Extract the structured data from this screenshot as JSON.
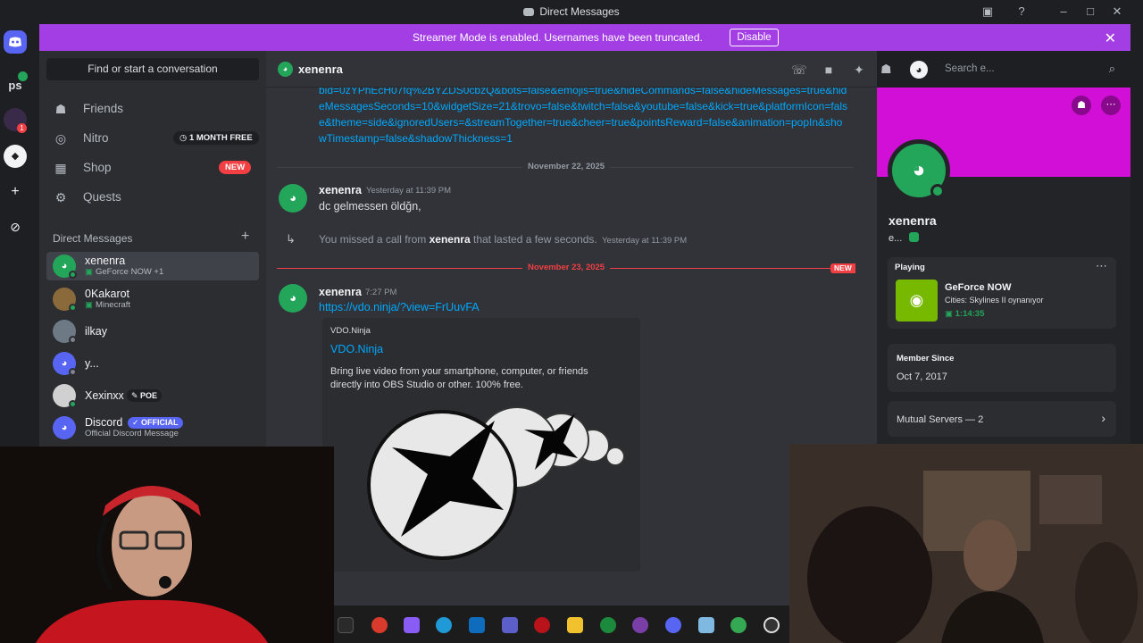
{
  "window": {
    "title": "Direct Messages"
  },
  "banner": {
    "message": "Streamer Mode is enabled. Usernames have been truncated.",
    "disable_label": "Disable",
    "color": "#a33de4"
  },
  "rail": {
    "guilds": [
      "ps"
    ],
    "badge_count": "1"
  },
  "sidebar": {
    "find_placeholder": "Find or start a conversation",
    "nav": [
      {
        "label": "Friends",
        "icon": "friends-icon"
      },
      {
        "label": "Nitro",
        "icon": "nitro-icon",
        "pill": "1 MONTH FREE"
      },
      {
        "label": "Shop",
        "icon": "shop-icon",
        "pill": "NEW"
      },
      {
        "label": "Quests",
        "icon": "quests-icon"
      }
    ],
    "dm_header": "Direct Messages",
    "dms": [
      {
        "name": "xenenra",
        "sub": "GeForce NOW +1",
        "status": "online"
      },
      {
        "name": "0Kakarot",
        "sub": "Minecraft",
        "status": "online"
      },
      {
        "name": "ilkay",
        "sub": "",
        "status": "offline"
      },
      {
        "name": "y...",
        "sub": "",
        "status": "offline"
      },
      {
        "name": "Xexinxx",
        "tag": "POE",
        "sub": "",
        "status": "online"
      },
      {
        "name": "Discord",
        "tag": "OFFICIAL",
        "sub": "Official Discord Message",
        "status": ""
      }
    ]
  },
  "chat": {
    "header_name": "xenenra",
    "search_placeholder": "Search e...",
    "link_block": "bid=0zYPhEcH07fq%2BYZDS0cbzQ&bots=false&emojis=true&hideCommands=false&hideMessages=true&hideMessagesSeconds=10&widgetSize=21&trovo=false&twitch=false&youtube=false&kick=true&platformIcon=false&theme=side&ignoredUsers=&streamTogether=true&cheer=true&pointsReward=false&animation=popIn&showTimestamp=false&shadowThickness=1",
    "date1": "November 22, 2025",
    "msg1": {
      "author": "xenenra",
      "time": "Yesterday at 11:39 PM",
      "text": "dc gelmessen öldğn,"
    },
    "call": {
      "prefix": "You missed a call from",
      "author": "xenenra",
      "suffix": "that lasted a few seconds.",
      "time": "Yesterday at 11:39 PM"
    },
    "date2": "November 23, 2025",
    "new_label": "NEW",
    "msg2": {
      "author": "xenenra",
      "time": "7:27 PM",
      "link": "https://vdo.ninja/?view=FrUuvFA"
    },
    "embed": {
      "provider": "VDO.Ninja",
      "title": "VDO.Ninja",
      "description": "Bring live video from your smartphone, computer, or friends directly into OBS Studio or other. 100% free."
    }
  },
  "profile": {
    "name": "xenenra",
    "subtitle": "e...",
    "playing_label": "Playing",
    "game": "GeForce NOW",
    "game_detail": "Cities: Skylines II oynanıyor",
    "elapsed": "1:14:35",
    "member_since_label": "Member Since",
    "member_since": "Oct 7, 2017",
    "mutual_servers": "Mutual Servers — 2",
    "cover_color": "#d10fd6"
  }
}
